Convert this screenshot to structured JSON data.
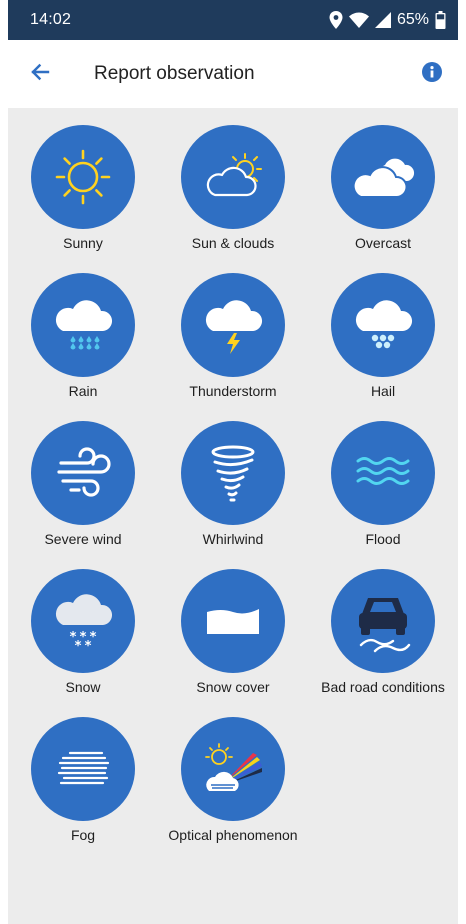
{
  "status_bar": {
    "time": "14:02",
    "battery_percent": "65%",
    "icons": [
      "location-icon",
      "wifi-icon",
      "signal-icon",
      "battery-icon"
    ]
  },
  "app_bar": {
    "title": "Report observation",
    "back_icon": "arrow-left-icon",
    "info_icon": "info-icon"
  },
  "colors": {
    "status_bar": "#1f3b5c",
    "circle": "#2f6fc3",
    "background": "#ececec",
    "info_icon": "#2f6fc3",
    "sun": "#ffd21f"
  },
  "options": [
    {
      "label": "Sunny",
      "icon": "sunny-icon"
    },
    {
      "label": "Sun & clouds",
      "icon": "sun-clouds-icon"
    },
    {
      "label": "Overcast",
      "icon": "overcast-icon"
    },
    {
      "label": "Rain",
      "icon": "rain-icon"
    },
    {
      "label": "Thunderstorm",
      "icon": "thunderstorm-icon"
    },
    {
      "label": "Hail",
      "icon": "hail-icon"
    },
    {
      "label": "Severe wind",
      "icon": "severe-wind-icon"
    },
    {
      "label": "Whirlwind",
      "icon": "whirlwind-icon"
    },
    {
      "label": "Flood",
      "icon": "flood-icon"
    },
    {
      "label": "Snow",
      "icon": "snow-icon"
    },
    {
      "label": "Snow cover",
      "icon": "snow-cover-icon"
    },
    {
      "label": "Bad road conditions",
      "icon": "bad-road-icon"
    },
    {
      "label": "Fog",
      "icon": "fog-icon"
    },
    {
      "label": "Optical phenomenon",
      "icon": "optical-phenomenon-icon"
    }
  ]
}
